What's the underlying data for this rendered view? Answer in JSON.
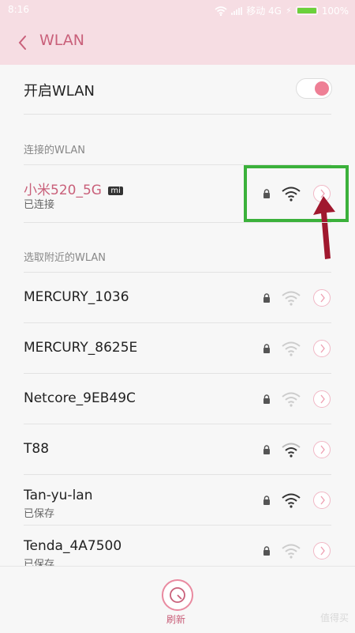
{
  "status_bar": {
    "time": "8:16",
    "carrier": "移动 4G",
    "battery": "100%",
    "battery_level": 1.0
  },
  "header": {
    "title": "WLAN"
  },
  "wlan_toggle": {
    "label": "开启WLAN",
    "on": true
  },
  "connected_section": {
    "title": "连接的WLAN",
    "network": {
      "name": "小米520_5G",
      "badge": "mi",
      "status": "已连接",
      "locked": true,
      "signal": "strong"
    }
  },
  "nearby_section": {
    "title": "选取附近的WLAN",
    "networks": [
      {
        "name": "MERCURY_1036",
        "status": "",
        "locked": true,
        "signal": "weak"
      },
      {
        "name": "MERCURY_8625E",
        "status": "",
        "locked": true,
        "signal": "weak"
      },
      {
        "name": "Netcore_9EB49C",
        "status": "",
        "locked": true,
        "signal": "weak"
      },
      {
        "name": "T88",
        "status": "",
        "locked": true,
        "signal": "medium"
      },
      {
        "name": "Tan-yu-lan",
        "status": "已保存",
        "locked": true,
        "signal": "strong"
      },
      {
        "name": "Tenda_4A7500",
        "status": "已保存",
        "locked": true,
        "signal": "weak"
      }
    ]
  },
  "bottom_bar": {
    "refresh_label": "刷新",
    "watermark": "值得买"
  },
  "colors": {
    "accent": "#c9607a",
    "header_bg": "#f6dde3",
    "highlight": "#3bb13b",
    "arrow": "#a0182e"
  }
}
